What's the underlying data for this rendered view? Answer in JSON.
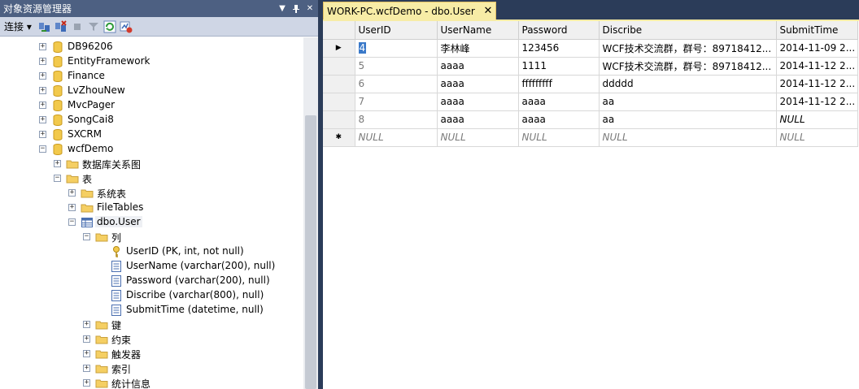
{
  "object_explorer": {
    "title": "对象资源管理器",
    "toolbar": {
      "connect_label": "连接"
    },
    "tree": [
      {
        "label": "DB96206",
        "icon": "database-icon",
        "expander": "+",
        "level": 0
      },
      {
        "label": "EntityFramework",
        "icon": "database-icon",
        "expander": "+",
        "level": 0
      },
      {
        "label": "Finance",
        "icon": "database-icon",
        "expander": "+",
        "level": 0
      },
      {
        "label": "LvZhouNew",
        "icon": "database-icon",
        "expander": "+",
        "level": 0
      },
      {
        "label": "MvcPager",
        "icon": "database-icon",
        "expander": "+",
        "level": 0
      },
      {
        "label": "SongCai8",
        "icon": "database-icon",
        "expander": "+",
        "level": 0
      },
      {
        "label": "SXCRM",
        "icon": "database-icon",
        "expander": "+",
        "level": 0
      },
      {
        "label": "wcfDemo",
        "icon": "database-icon",
        "expander": "-",
        "level": 0
      },
      {
        "label": "数据库关系图",
        "icon": "folder-icon",
        "expander": "+",
        "level": 1
      },
      {
        "label": "表",
        "icon": "folder-icon",
        "expander": "-",
        "level": 1
      },
      {
        "label": "系统表",
        "icon": "folder-icon",
        "expander": "+",
        "level": 2
      },
      {
        "label": "FileTables",
        "icon": "folder-icon",
        "expander": "+",
        "level": 2
      },
      {
        "label": "dbo.User",
        "icon": "table-icon",
        "expander": "-",
        "level": 2,
        "selected": true
      },
      {
        "label": "列",
        "icon": "folder-icon",
        "expander": "-",
        "level": 3
      },
      {
        "label": "UserID (PK, int, not null)",
        "icon": "key-icon",
        "expander": "",
        "level": 4
      },
      {
        "label": "UserName (varchar(200), null)",
        "icon": "column-icon",
        "expander": "",
        "level": 4
      },
      {
        "label": "Password (varchar(200), null)",
        "icon": "column-icon",
        "expander": "",
        "level": 4
      },
      {
        "label": "Discribe (varchar(800), null)",
        "icon": "column-icon",
        "expander": "",
        "level": 4
      },
      {
        "label": "SubmitTime (datetime, null)",
        "icon": "column-icon",
        "expander": "",
        "level": 4
      },
      {
        "label": "键",
        "icon": "folder-icon",
        "expander": "+",
        "level": 3
      },
      {
        "label": "约束",
        "icon": "folder-icon",
        "expander": "+",
        "level": 3
      },
      {
        "label": "触发器",
        "icon": "folder-icon",
        "expander": "+",
        "level": 3
      },
      {
        "label": "索引",
        "icon": "folder-icon",
        "expander": "+",
        "level": 3
      },
      {
        "label": "统计信息",
        "icon": "folder-icon",
        "expander": "+",
        "level": 3
      }
    ]
  },
  "document": {
    "tab_title": "WORK-PC.wcfDemo - dbo.User",
    "close_glyph": "✕",
    "columns": [
      "UserID",
      "UserName",
      "Password",
      "Discribe",
      "SubmitTime"
    ],
    "rows": [
      {
        "marker": "▶",
        "cells": [
          "4",
          "李林峰",
          "123456",
          "WCF技术交流群，群号：89718412...",
          "2014-11-09 2..."
        ],
        "dim": false
      },
      {
        "marker": "",
        "cells": [
          "5",
          "aaaa",
          "1111",
          "WCF技术交流群，群号：89718412...",
          "2014-11-12 2..."
        ],
        "dim": false
      },
      {
        "marker": "",
        "cells": [
          "6",
          "aaaa",
          "fffffffff",
          "ddddd",
          "2014-11-12 2..."
        ],
        "dim": false
      },
      {
        "marker": "",
        "cells": [
          "7",
          "aaaa",
          "aaaa",
          "aa",
          "2014-11-12 2..."
        ],
        "dim": false
      },
      {
        "marker": "",
        "cells": [
          "8",
          "aaaa",
          "aaaa",
          "aa",
          "NULL"
        ],
        "dim": false
      },
      {
        "marker": "✱",
        "cells": [
          "NULL",
          "NULL",
          "NULL",
          "NULL",
          "NULL"
        ],
        "dim": true
      }
    ]
  },
  "colors": {
    "title_bar": "#4d6082",
    "background": "#2b3c59",
    "tab_active": "#f7eca6",
    "selection": "#3a79c9"
  }
}
